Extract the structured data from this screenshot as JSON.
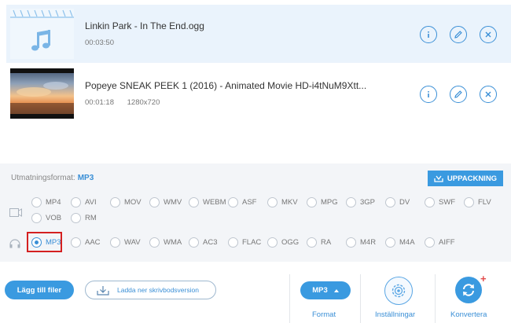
{
  "files": [
    {
      "name": "Linkin Park - In The End.ogg",
      "duration": "00:03:50",
      "resolution": "",
      "thumb": "music-note-icon",
      "selected": true
    },
    {
      "name": "Popeye SNEAK PEEK 1 (2016) - Animated Movie HD-i4tNuM9Xtt...",
      "duration": "00:01:18",
      "resolution": "1280x720",
      "thumb": "video-thumbnail",
      "selected": false
    }
  ],
  "output": {
    "label": "Utmatningsformat:",
    "value": "MP3"
  },
  "unpack_button": "UPPACKNING",
  "video_formats": [
    "MP4",
    "AVI",
    "MOV",
    "WMV",
    "WEBM",
    "ASF",
    "MKV",
    "MPG",
    "3GP",
    "DV",
    "SWF",
    "FLV",
    "VOB",
    "RM"
  ],
  "audio_formats": [
    "MP3",
    "AAC",
    "WAV",
    "WMA",
    "AC3",
    "FLAC",
    "OGG",
    "RA",
    "M4R",
    "M4A",
    "AIFF"
  ],
  "selected_format": "MP3",
  "bottom": {
    "add_files": "Lägg till filer",
    "download_desktop": "Ladda ner skrivbodsversion",
    "format_pill": "MP3",
    "format_label": "Format",
    "settings_label": "Inställningar",
    "convert_label": "Konvertera"
  },
  "colors": {
    "accent": "#3a9ae0",
    "selection_border": "#d42020",
    "selected_row": "#eaf3fc"
  }
}
